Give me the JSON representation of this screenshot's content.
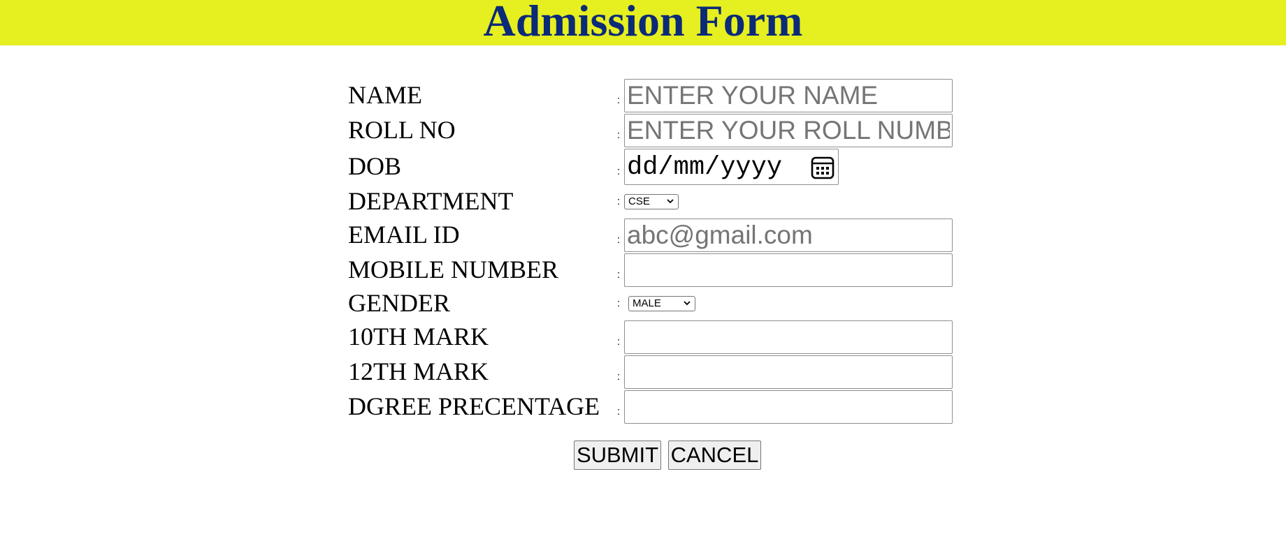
{
  "header": {
    "title": "Admission Form"
  },
  "form": {
    "separator": ":",
    "name": {
      "label": "NAME",
      "placeholder": "ENTER YOUR NAME"
    },
    "roll_no": {
      "label": "ROLL NO",
      "placeholder": "ENTER YOUR ROLL NUMBER"
    },
    "dob": {
      "label": "DOB",
      "value": "dd/mm/yyyy"
    },
    "department": {
      "label": "DEPARTMENT",
      "selected": "CSE"
    },
    "email": {
      "label": "EMAIL ID",
      "placeholder": "abc@gmail.com"
    },
    "mobile": {
      "label": "MOBILE NUMBER",
      "value": ""
    },
    "gender": {
      "label": "GENDER",
      "selected": "MALE"
    },
    "mark10": {
      "label": "10TH MARK",
      "value": ""
    },
    "mark12": {
      "label": "12TH MARK",
      "value": ""
    },
    "degree": {
      "label": "DGREE PRECENTAGE",
      "value": ""
    }
  },
  "actions": {
    "submit_label": "SUBMIT",
    "cancel_label": "CANCEL"
  },
  "icons": {
    "calendar": "calendar-icon",
    "dropdown": "chevron-down-icon"
  },
  "colors": {
    "banner_bg": "#e6ef1f",
    "title": "#0b2a78"
  }
}
